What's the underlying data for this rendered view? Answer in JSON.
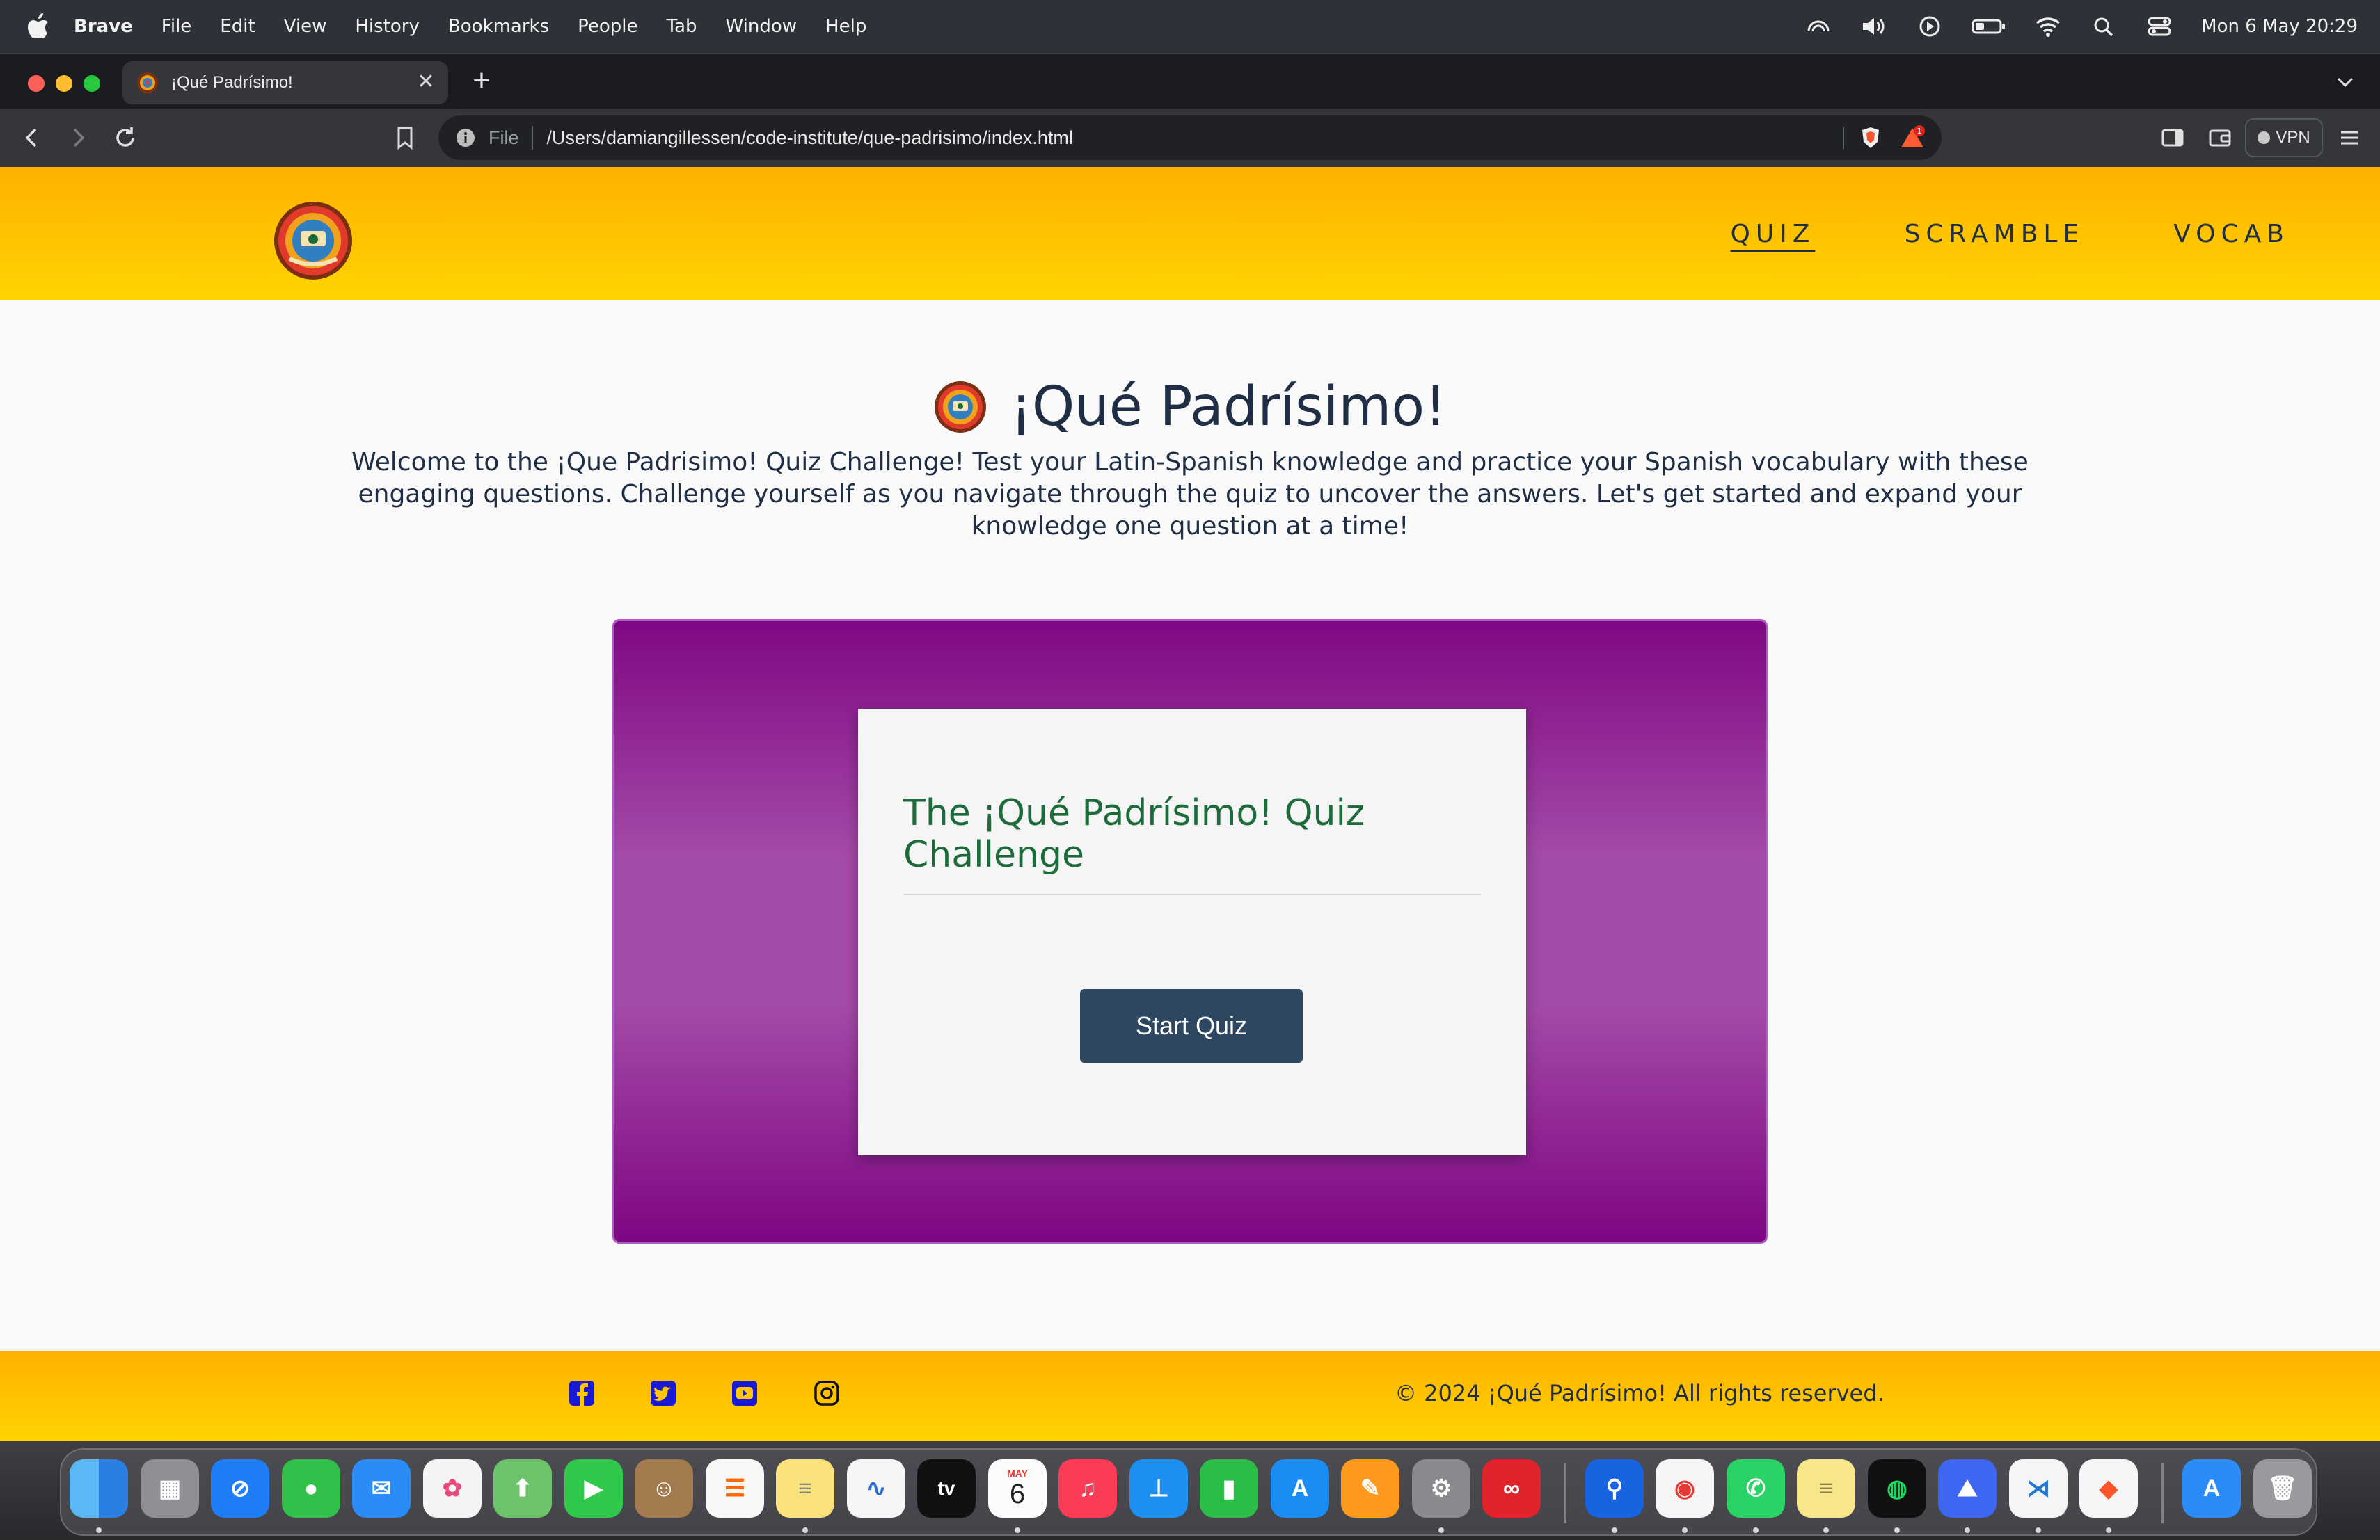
{
  "menubar": {
    "app_name": "Brave",
    "items": [
      "File",
      "Edit",
      "View",
      "History",
      "Bookmarks",
      "People",
      "Tab",
      "Window",
      "Help"
    ],
    "clock": "Mon 6 May  20:29"
  },
  "browser": {
    "tab_title": "¡Qué Padrísimo!",
    "tab_close": "✕",
    "new_tab": "+",
    "url_scheme": "File",
    "url_path": "/Users/damiangillessen/code-institute/que-padrisimo/index.html",
    "rewards_badge": "1",
    "vpn_label": "VPN"
  },
  "site": {
    "nav": [
      "QUIZ",
      "SCRAMBLE",
      "VOCAB"
    ],
    "title": "¡Qué Padrísimo!",
    "intro": "Welcome to the ¡Que Padrisimo! Quiz Challenge! Test your Latin-Spanish knowledge and practice your Spanish vocabulary with these engaging questions. Challenge yourself as you navigate through the quiz to uncover the answers. Let's get started and expand your knowledge one question at a time!",
    "quiz_heading": "The ¡Qué Padrísimo! Quiz Challenge",
    "start_button": "Start Quiz",
    "copyright": "© 2024 ¡Qué Padrísimo! All rights reserved."
  },
  "colors": {
    "header_gradient": [
      "#ffb100",
      "#ffd400"
    ],
    "quiz_purple": "#7f0884",
    "button_navy": "#2e4761",
    "heading_green": "#1d6b3b",
    "text_navy": "#1f2e44"
  },
  "dock": {
    "calendar_month": "MAY",
    "calendar_day": "6",
    "apps": [
      "finder-icon",
      "launchpad-icon",
      "safari-icon",
      "messages-icon",
      "mail-icon",
      "photos-icon",
      "maps-icon",
      "facetime-icon",
      "contacts-icon",
      "reminders-icon",
      "notes-icon",
      "freeform-icon",
      "apple-tv-icon",
      "calendar-icon",
      "music-icon",
      "keynote-icon",
      "numbers-icon",
      "app-store-icon",
      "pages-icon",
      "system-settings-icon",
      "creative-cloud-icon",
      "maps-pin-icon",
      "chrome-icon",
      "whatsapp-icon",
      "stickies-icon",
      "spotify-icon",
      "nordvpn-icon",
      "vscode-icon",
      "brave-icon",
      "app-store-downloads-icon",
      "trash-icon"
    ]
  }
}
